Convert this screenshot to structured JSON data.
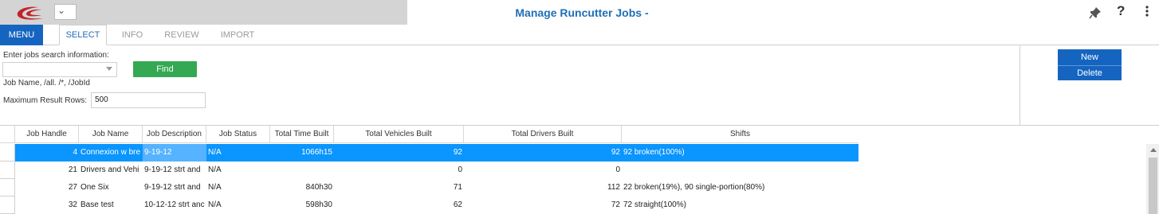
{
  "window": {
    "title": "Manage Runcutter Jobs -",
    "help_glyph": "?",
    "logo_color": "#c0242b",
    "accent_color": "#1565c0"
  },
  "tabs": {
    "menu": "MENU",
    "items": [
      "SELECT",
      "INFO",
      "REVIEW",
      "IMPORT"
    ],
    "active": "SELECT"
  },
  "search": {
    "prompt": "Enter jobs search information:",
    "combo_value": "",
    "find_label": "Find",
    "hint": "Job Name, /all. /*, /JobId",
    "max_rows_label": "Maximum Result Rows:",
    "max_rows_value": "500"
  },
  "actions": {
    "new_label": "New",
    "delete_label": "Delete"
  },
  "grid": {
    "columns": [
      "Job Handle",
      "Job Name",
      "Job Description",
      "Job Status",
      "Total Time Built",
      "Total Vehicles Built",
      "Total Drivers Built",
      "Shifts"
    ],
    "rows": [
      {
        "handle": "4",
        "name": "Connexion w bre",
        "desc": "9-19-12",
        "status": "N/A",
        "time": "1066h15",
        "vehicles": "92",
        "drivers": "92",
        "shifts": "92 broken(100%)"
      },
      {
        "handle": "21",
        "name": "Drivers and Vehi",
        "desc": "9-19-12 strt and",
        "status": "N/A",
        "time": "",
        "vehicles": "0",
        "drivers": "0",
        "shifts": ""
      },
      {
        "handle": "27",
        "name": "One Six",
        "desc": "9-19-12 strt and",
        "status": "N/A",
        "time": "840h30",
        "vehicles": "71",
        "drivers": "112",
        "shifts": "22 broken(19%), 90 single-portion(80%)"
      },
      {
        "handle": "32",
        "name": "Base test",
        "desc": "10-12-12 strt anc",
        "status": "N/A",
        "time": "598h30",
        "vehicles": "62",
        "drivers": "72",
        "shifts": "72 straight(100%)"
      }
    ],
    "selected_row": 0,
    "selected_color": "#0a95ff"
  },
  "icons": [
    "logo-icon",
    "chevron-down-icon",
    "pin-icon",
    "help-icon",
    "more-vertical-icon",
    "scroll-up-icon"
  ]
}
